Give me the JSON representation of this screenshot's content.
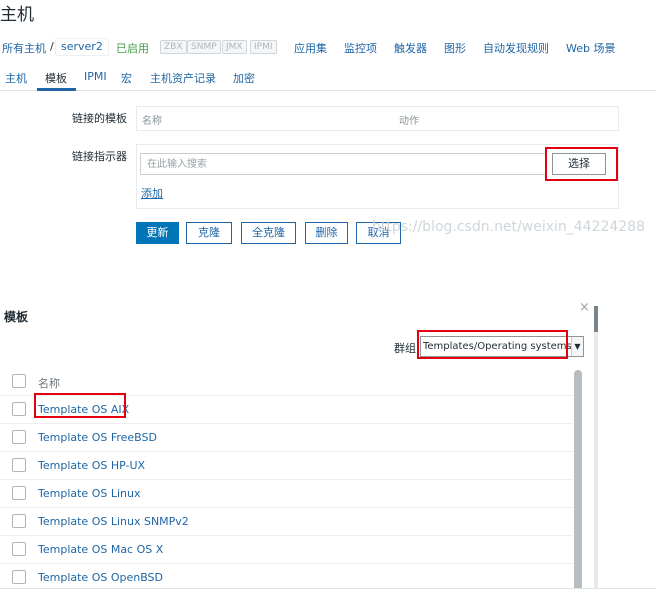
{
  "page": {
    "title": "主机"
  },
  "host_nav": {
    "all_hosts": "所有主机",
    "separator": "/",
    "host": "server2",
    "status": "已启用",
    "availability": [
      "ZBX",
      "SNMP",
      "JMX",
      "IPMI"
    ],
    "links": [
      "应用集",
      "监控项",
      "触发器",
      "图形",
      "自动发现规则",
      "Web 场景"
    ]
  },
  "tabs": [
    "主机",
    "模板",
    "IPMI",
    "宏",
    "主机资产记录",
    "加密"
  ],
  "form": {
    "linked_templates_label": "链接的模板",
    "col_name": "名称",
    "col_action": "动作",
    "link_indicator_label": "链接指示器",
    "search_placeholder": "在此输入搜索",
    "select_button": "选择",
    "add_link": "添加",
    "buttons": {
      "update": "更新",
      "clone": "克隆",
      "full_clone": "全克隆",
      "delete": "删除",
      "cancel": "取消"
    }
  },
  "watermark": "https://blog.csdn.net/weixin_44224288",
  "modal": {
    "close": "×",
    "title": "模板",
    "group_label": "群组",
    "group_value": "Templates/Operating systems",
    "header_name": "名称",
    "templates": [
      "Template OS AIX",
      "Template OS FreeBSD",
      "Template OS HP-UX",
      "Template OS Linux",
      "Template OS Linux SNMPv2",
      "Template OS Mac OS X",
      "Template OS OpenBSD"
    ]
  },
  "colors": {
    "link": "#1f65a6",
    "primary": "#0275b8",
    "enabled": "#429e47",
    "highlight": "#e3000f"
  }
}
